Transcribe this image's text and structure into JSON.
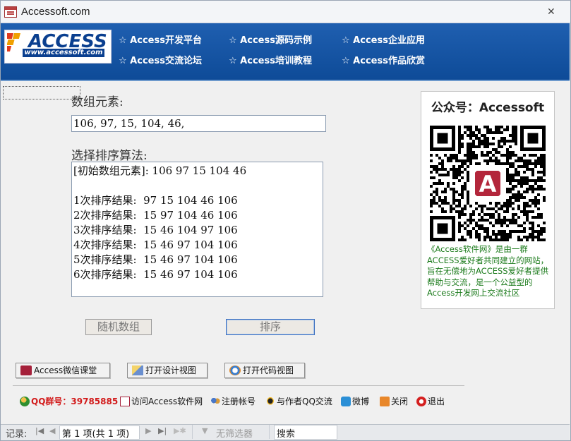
{
  "window": {
    "title": "Accessoft.com",
    "close_glyph": "✕"
  },
  "header": {
    "logo_text": "ACCESS",
    "logo_url": "www.accessoft.com",
    "nav": [
      "☆ Access开发平台",
      "☆ Access源码示例",
      "☆ Access企业应用",
      "☆ Access交流论坛",
      "☆ Access培训教程",
      "☆ Access作品欣赏"
    ]
  },
  "form": {
    "array_label": "数组元素:",
    "array_value": "106, 97, 15, 104, 46,",
    "algo_label": "选择排序算法:",
    "result_lines": [
      "[初始数组元素]: 106 97 15 104 46",
      "",
      "1次排序结果:  97 15 104 46 106",
      "2次排序结果:  15 97 104 46 106",
      "3次排序结果:  15 46 104 97 106",
      "4次排序结果:  15 46 97 104 106",
      "5次排序结果:  15 46 97 104 106",
      "6次排序结果:  15 46 97 104 106"
    ],
    "random_button": "随机数组",
    "sort_button": "排序"
  },
  "qr_panel": {
    "title": "公众号：Accessoft",
    "description": "《Access软件网》是由一群ACCESS爱好者共同建立的网站，旨在无偿地为ACCESS爱好者提供帮助与交流，是一个公益型的Access开发网上交流社区"
  },
  "actions": {
    "wechat_class": "Access微信课堂",
    "open_design": "打开设计视图",
    "open_code": "打开代码视图"
  },
  "links": {
    "qq_group": "QQ群号：39785885",
    "visit_site": "访问Access软件网",
    "register": "注册帐号",
    "qq_chat": "与作者QQ交流",
    "weibo": "微博",
    "close": "关闭",
    "exit": "退出"
  },
  "record_bar": {
    "label": "记录:",
    "position": "第 1 项(共 1 项)",
    "filter": "无筛选器",
    "search": "搜索"
  },
  "colors": {
    "banner": "#1f5fb0",
    "qq_red": "#d21b1b",
    "desc_green": "#1a7a1a"
  }
}
